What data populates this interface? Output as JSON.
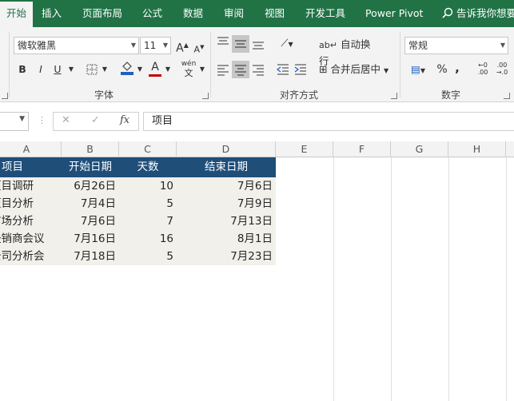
{
  "tabs": [
    "开始",
    "插入",
    "页面布局",
    "公式",
    "数据",
    "审阅",
    "视图",
    "开发工具",
    "Power Pivot"
  ],
  "tell_me": "告诉我你想要",
  "ribbon": {
    "font_name": "微软雅黑",
    "font_size": "11",
    "grow_font": "A",
    "shrink_font": "A",
    "bold": "B",
    "italic": "I",
    "underline": "U",
    "font_color": "A",
    "phonetic": "wén",
    "group_font": "字体",
    "wrap_text": "自动换行",
    "merge_center": "合并后居中",
    "group_align": "对齐方式",
    "number_format": "常规",
    "percent": "%",
    "comma": ",",
    "inc_decimal_top": "←0",
    "inc_decimal_bottom": ".00",
    "dec_decimal_top": ".00",
    "dec_decimal_bottom": "→.0",
    "group_number": "数字"
  },
  "formula_bar": {
    "cancel": "✕",
    "enter": "✓",
    "fx": "fx",
    "content": "项目"
  },
  "columns": [
    "A",
    "B",
    "C",
    "D",
    "E",
    "F",
    "G",
    "H"
  ],
  "table": {
    "header": [
      "项目",
      "开始日期",
      "天数",
      "结束日期"
    ],
    "rows": [
      [
        "项目调研",
        "6月26日",
        "10",
        "7月6日"
      ],
      [
        "项目分析",
        "7月4日",
        "5",
        "7月9日"
      ],
      [
        "市场分析",
        "7月6日",
        "7",
        "7月13日"
      ],
      [
        "经销商会议",
        "7月16日",
        "16",
        "8月1日"
      ],
      [
        "公司分析会",
        "7月18日",
        "5",
        "7月23日"
      ]
    ]
  },
  "colors": {
    "excel_green": "#217346",
    "table_header": "#1f4e79",
    "table_body": "#f2f0eb"
  }
}
